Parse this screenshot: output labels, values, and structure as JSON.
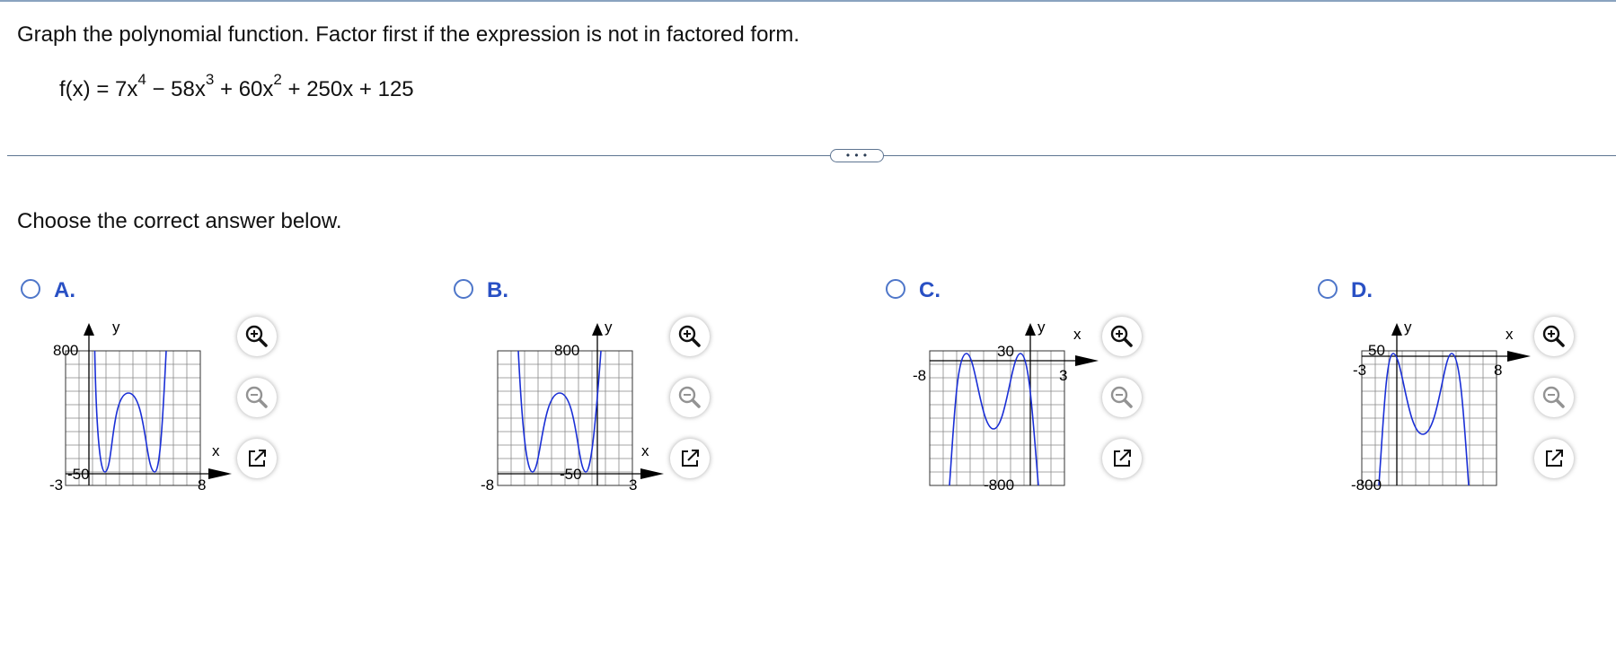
{
  "prompt": "Graph the polynomial function. Factor first if the expression is not in factored form.",
  "function": {
    "lhs": "f(x) = 7x",
    "e1": "4",
    "t2": " − 58x",
    "e2": "3",
    "t3": " + 60x",
    "e3": "2",
    "t4": " + 250x + 125"
  },
  "more_button": "• • •",
  "choose": "Choose the correct answer below.",
  "curve_color": "#1a2fd6",
  "options": [
    {
      "label": "A.",
      "tick_top": "800",
      "tick_bottom": "-50",
      "tick_left": "-3",
      "tick_right": "8",
      "x_axis": "x",
      "y_axis": "y"
    },
    {
      "label": "B.",
      "tick_top": "800",
      "tick_bottom": "-50",
      "tick_left": "-8",
      "tick_right": "3",
      "x_axis": "x",
      "y_axis": "y"
    },
    {
      "label": "C.",
      "tick_top": "30",
      "tick_bottom": "-800",
      "tick_left": "-8",
      "tick_right": "3",
      "x_axis": "x",
      "y_axis": "y"
    },
    {
      "label": "D.",
      "tick_top": "50",
      "tick_bottom": "-800",
      "tick_left": "-3",
      "tick_right": "8",
      "x_axis": "x",
      "y_axis": "y"
    }
  ],
  "tools": [
    "zoom-in-icon",
    "zoom-out-icon",
    "popout-icon"
  ]
}
